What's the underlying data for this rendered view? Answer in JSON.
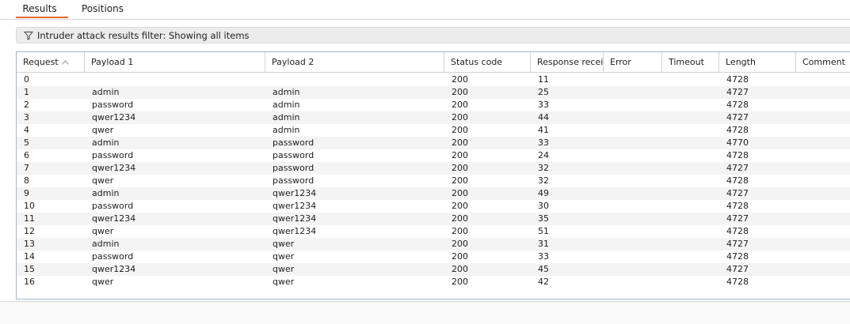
{
  "tabs": {
    "results": "Results",
    "positions": "Positions"
  },
  "filter": {
    "text": "Intruder attack results filter: Showing all items"
  },
  "table": {
    "columns": [
      "Request",
      "Payload 1",
      "Payload 2",
      "Status code",
      "Response recei...",
      "Error",
      "Timeout",
      "Length",
      "Comment"
    ],
    "sorted_column_indicator": "^",
    "rows": [
      [
        "0",
        "",
        "",
        "200",
        "11",
        "",
        "",
        "4728",
        ""
      ],
      [
        "1",
        "admin",
        "admin",
        "200",
        "25",
        "",
        "",
        "4727",
        ""
      ],
      [
        "2",
        "password",
        "admin",
        "200",
        "33",
        "",
        "",
        "4728",
        ""
      ],
      [
        "3",
        "qwer1234",
        "admin",
        "200",
        "44",
        "",
        "",
        "4727",
        ""
      ],
      [
        "4",
        "qwer",
        "admin",
        "200",
        "41",
        "",
        "",
        "4728",
        ""
      ],
      [
        "5",
        "admin",
        "password",
        "200",
        "33",
        "",
        "",
        "4770",
        ""
      ],
      [
        "6",
        "password",
        "password",
        "200",
        "24",
        "",
        "",
        "4728",
        ""
      ],
      [
        "7",
        "qwer1234",
        "password",
        "200",
        "32",
        "",
        "",
        "4727",
        ""
      ],
      [
        "8",
        "qwer",
        "password",
        "200",
        "32",
        "",
        "",
        "4728",
        ""
      ],
      [
        "9",
        "admin",
        "qwer1234",
        "200",
        "49",
        "",
        "",
        "4727",
        ""
      ],
      [
        "10",
        "password",
        "qwer1234",
        "200",
        "30",
        "",
        "",
        "4728",
        ""
      ],
      [
        "11",
        "qwer1234",
        "qwer1234",
        "200",
        "35",
        "",
        "",
        "4727",
        ""
      ],
      [
        "12",
        "qwer",
        "qwer1234",
        "200",
        "51",
        "",
        "",
        "4728",
        ""
      ],
      [
        "13",
        "admin",
        "qwer",
        "200",
        "31",
        "",
        "",
        "4727",
        ""
      ],
      [
        "14",
        "password",
        "qwer",
        "200",
        "33",
        "",
        "",
        "4728",
        ""
      ],
      [
        "15",
        "qwer1234",
        "qwer",
        "200",
        "45",
        "",
        "",
        "4727",
        ""
      ],
      [
        "16",
        "qwer",
        "qwer",
        "200",
        "42",
        "",
        "",
        "4728",
        ""
      ]
    ]
  },
  "colors": {
    "accent": "#e8692d",
    "table_border": "#a3b6cb",
    "filter_bg": "#ececec"
  },
  "icons": {
    "filter": "filter-funnel-icon",
    "sort": "sort-ascending-icon"
  }
}
